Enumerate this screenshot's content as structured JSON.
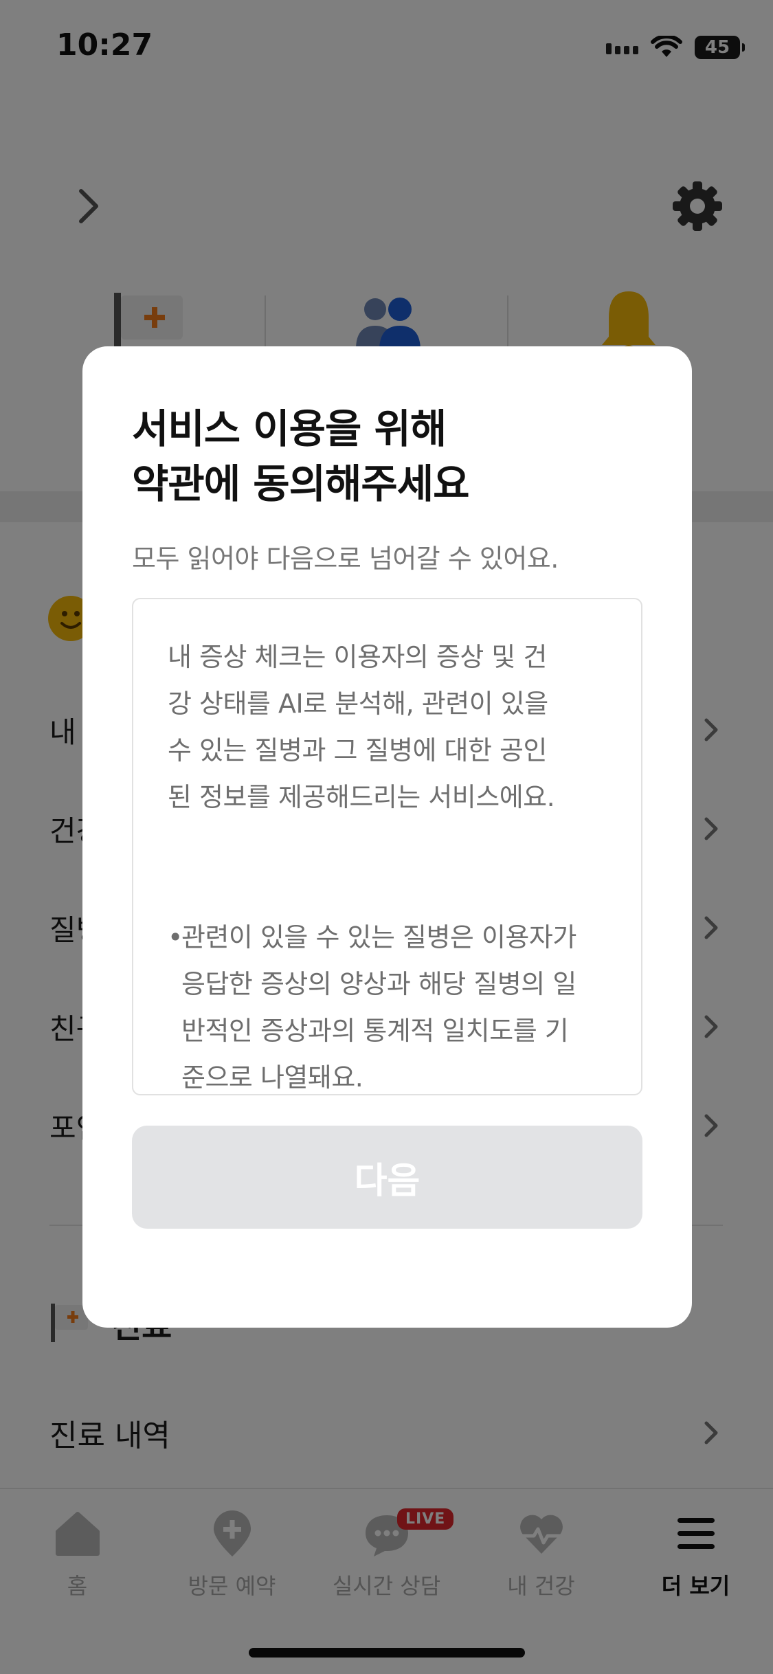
{
  "status_bar": {
    "time": "10:27",
    "battery": "45"
  },
  "menu": {
    "items": [
      {
        "label": "내"
      },
      {
        "label": "건강"
      },
      {
        "label": "질병"
      },
      {
        "label": "친구"
      },
      {
        "label": "포인트"
      }
    ]
  },
  "section": {
    "title": "진료",
    "history_label": "진료 내역"
  },
  "bottom_nav": {
    "items": [
      {
        "label": "홈",
        "icon": "home-icon"
      },
      {
        "label": "방문 예약",
        "icon": "location-plus-icon"
      },
      {
        "label": "실시간 상담",
        "icon": "chat-icon",
        "badge": "LIVE"
      },
      {
        "label": "내 건강",
        "icon": "heart-pulse-icon"
      },
      {
        "label": "더 보기",
        "icon": "menu-icon"
      }
    ]
  },
  "modal": {
    "title_line1": "서비스 이용을 위해",
    "title_line2": "약관에 동의해주세요",
    "subtitle": "모두 읽어야 다음으로 넘어갈 수 있어요.",
    "terms": {
      "para_lines": [
        "내 증상 체크는 이용자의 증상 및 건",
        "강 상태를 AI로 분석해, 관련이 있을",
        "수 있는 질병과 그 질병에 대한 공인",
        "된 정보를 제공해드리는 서비스에요."
      ],
      "bullet_lines": [
        "관련이 있을 수 있는 질병은 이용자가",
        "응답한 증상의 양상과 해당 질병의 일",
        "반적인 증상과의 통계적 일치도를 기",
        "준으로 나열돼요."
      ]
    },
    "next_button": "다음"
  },
  "colors": {
    "live_badge": "#e0262c",
    "bell": "#f5b90a",
    "flag_plus": "#f07a1a",
    "users_blue": "#1f5fd6"
  }
}
